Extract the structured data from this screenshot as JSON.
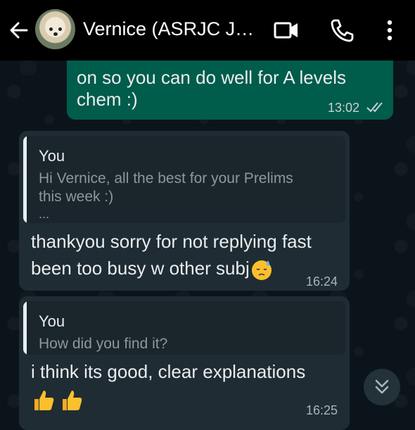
{
  "header": {
    "title": "Vernice (ASRJC J…",
    "back_icon": "arrow-left-icon",
    "video_icon": "video-camera-icon",
    "call_icon": "phone-icon",
    "menu_icon": "more-vertical-icon"
  },
  "messages": [
    {
      "direction": "outgoing",
      "lines": [
        "on so you can do well for A levels",
        "chem :)"
      ],
      "time": "13:02",
      "status": "read-double-check"
    },
    {
      "direction": "incoming",
      "quote": {
        "author": "You",
        "lines": [
          "Hi Vernice, all the best for your Prelims",
          "this week :)",
          "..."
        ]
      },
      "lines": [
        "thankyou sorry for not replying fast",
        "been too busy w other subj"
      ],
      "emoji": "downcast-sweat-face-emoji",
      "time": "16:24"
    },
    {
      "direction": "incoming",
      "quote": {
        "author": "You",
        "lines": [
          "How did you find it?"
        ]
      },
      "lines": [
        "i think its good, clear explanations"
      ],
      "emoji": "thumbs-up-emoji x2",
      "time": "16:25"
    }
  ],
  "colors": {
    "outgoing_bubble": "#005c4b",
    "incoming_bubble": "#202c33",
    "background": "#0b141a"
  },
  "scroll_button_icon": "double-chevron-down-icon"
}
